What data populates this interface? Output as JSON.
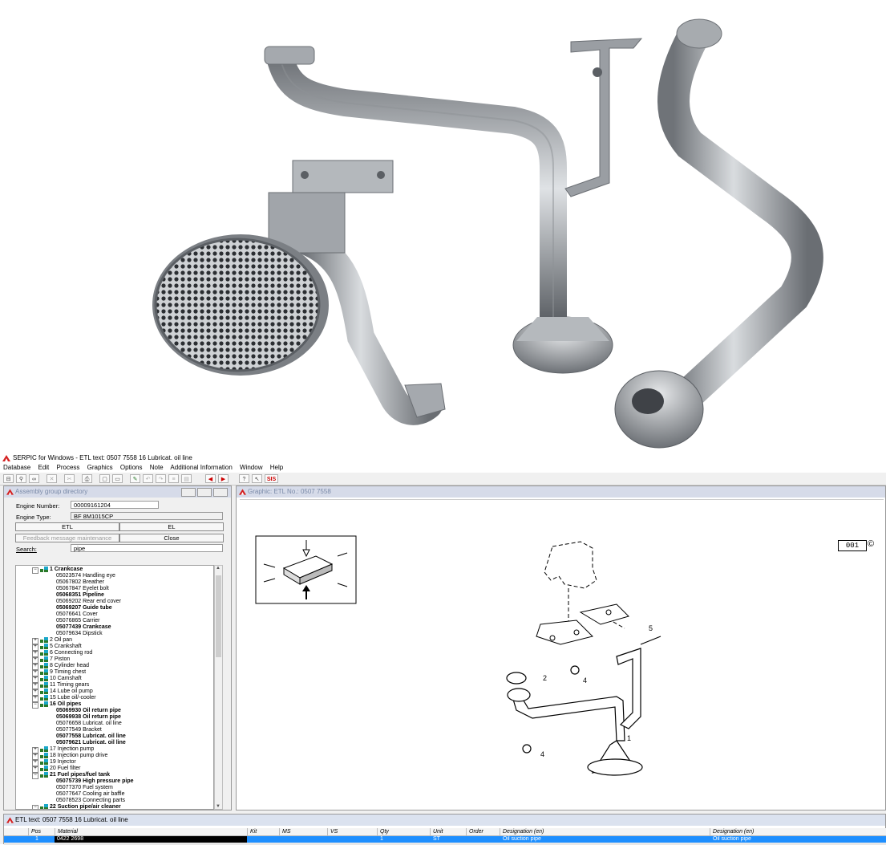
{
  "window": {
    "title": "SERPIC for Windows - ETL text: 0507 7558    16   Lubricat. oil line"
  },
  "menu": [
    "Database",
    "Edit",
    "Process",
    "Graphics",
    "Options",
    "Note",
    "Additional Information",
    "Window",
    "Help"
  ],
  "toolbar": {
    "sis_label": "SIS"
  },
  "assembly_panel": {
    "title": "Assembly group directory",
    "engine_number_label": "Engine Number:",
    "engine_number": "00009161204",
    "engine_type_label": "Engine Type:",
    "engine_type": "BF 8M1015CP",
    "etl_button": "ETL",
    "el_button": "EL",
    "feedback_button": "Feedback message maintenance",
    "close_button": "Close",
    "search_label": "Search:",
    "search_value": "pipe",
    "tree": [
      {
        "text": "1   Crankcase",
        "level": 0,
        "bold": true,
        "expanded": true
      },
      {
        "text": "05023574  Handling eye",
        "level": 1
      },
      {
        "text": "05067802  Breather",
        "level": 1
      },
      {
        "text": "05067847  Eyelet bolt",
        "level": 1
      },
      {
        "text": "05068351  Pipeline",
        "level": 1,
        "bold": true
      },
      {
        "text": "05069202  Rear end cover",
        "level": 1
      },
      {
        "text": "05069207  Guide tube",
        "level": 1,
        "bold": true
      },
      {
        "text": "05076641  Cover",
        "level": 1
      },
      {
        "text": "05076865  Carrier",
        "level": 1
      },
      {
        "text": "05077439  Crankcase",
        "level": 1,
        "bold": true
      },
      {
        "text": "05079634  Dipstick",
        "level": 1
      },
      {
        "text": "2  Oil pan",
        "level": 0
      },
      {
        "text": "5  Crankshaft",
        "level": 0
      },
      {
        "text": "6  Connecting rod",
        "level": 0
      },
      {
        "text": "7  Piston",
        "level": 0
      },
      {
        "text": "8  Cylinder head",
        "level": 0
      },
      {
        "text": "9  Timing chest",
        "level": 0
      },
      {
        "text": "10  Camshaft",
        "level": 0
      },
      {
        "text": "11  Timing gears",
        "level": 0
      },
      {
        "text": "14  Lube oil pump",
        "level": 0
      },
      {
        "text": "15  Lube oil/-cooler",
        "level": 0
      },
      {
        "text": "16   Oil pipes",
        "level": 0,
        "bold": true,
        "expanded": true
      },
      {
        "text": "05069930  Oil return pipe",
        "level": 1,
        "bold": true
      },
      {
        "text": "05069938  Oil return pipe",
        "level": 1,
        "bold": true
      },
      {
        "text": "05076658  Lubricat. oil line",
        "level": 1
      },
      {
        "text": "05077549  Bracket",
        "level": 1
      },
      {
        "text": "05077558  Lubricat. oil line",
        "level": 1,
        "bold": true
      },
      {
        "text": "05079621  Lubricat. oil line",
        "level": 1,
        "bold": true
      },
      {
        "text": "17  Injection pump",
        "level": 0
      },
      {
        "text": "18  Injection pump drive",
        "level": 0
      },
      {
        "text": "19  Injector",
        "level": 0
      },
      {
        "text": "20  Fuel filter",
        "level": 0
      },
      {
        "text": "21   Fuel pipes/fuel tank",
        "level": 0,
        "bold": true,
        "expanded": true
      },
      {
        "text": "05075739  High pressure pipe",
        "level": 1,
        "bold": true
      },
      {
        "text": "05077370  Fuel system",
        "level": 1
      },
      {
        "text": "05077647  Cooling air baffle",
        "level": 1
      },
      {
        "text": "05078523  Connecting parts",
        "level": 1
      },
      {
        "text": "22   Suction pipe/air cleaner",
        "level": 0,
        "bold": true,
        "expanded": true
      }
    ]
  },
  "graphic_panel": {
    "title": "Graphic: ETL No.: 0507 7558",
    "page_code": "001",
    "copyright_mark": "©",
    "callouts": [
      "1",
      "2",
      "4",
      "4",
      "5"
    ]
  },
  "etl_panel": {
    "title": "ETL text: 0507 7558    16   Lubricat. oil line",
    "columns": [
      "Pos",
      "Material",
      "Kit",
      "MS",
      "VS",
      "Qty",
      "Unit",
      "Order",
      "Designation (en)",
      "Designation (en)"
    ],
    "selected_row": {
      "pos": "1",
      "material": "0422 2698",
      "qty": "1",
      "unit": "ST",
      "designation_1": "Oil suction pipe",
      "designation_2": "Oil suction pipe"
    }
  },
  "colors": {
    "selection": "#1e8fff",
    "panel_title_bg": "#d6dbe9",
    "panel_title_fg": "#7a8aa8",
    "logo_red": "#d42020"
  }
}
